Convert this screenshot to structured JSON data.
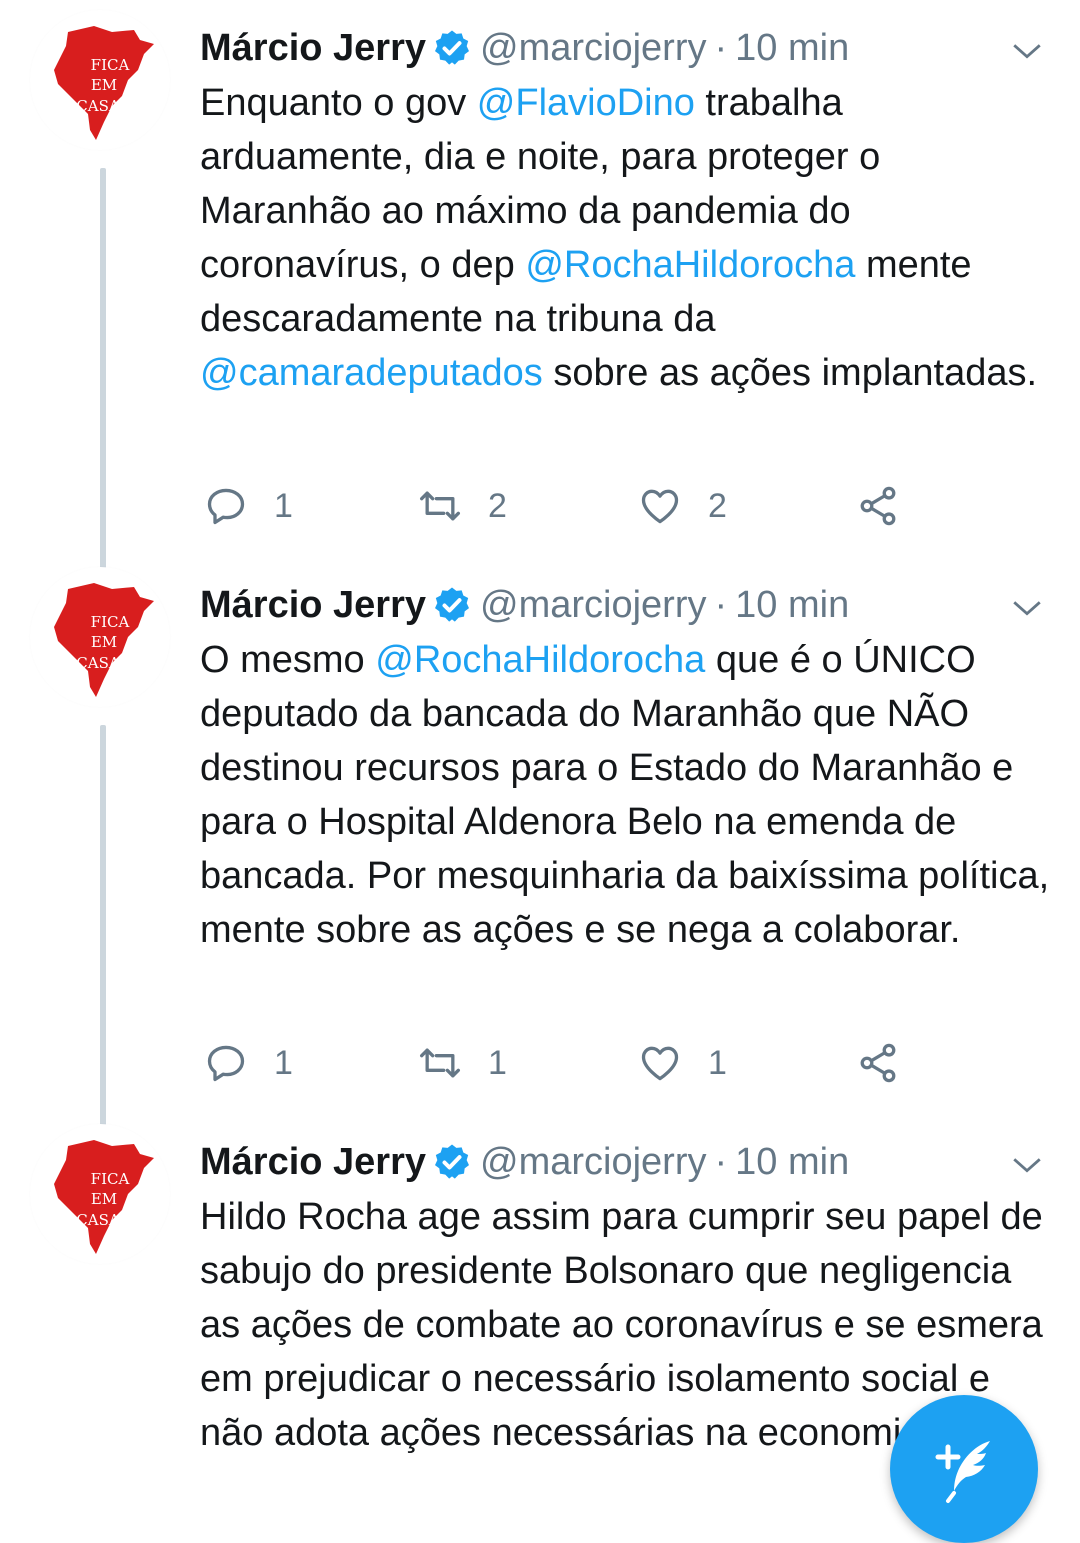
{
  "fab": {
    "icon": "compose-tweet-icon"
  },
  "colors": {
    "accent": "#1da1f2",
    "secondary_text": "#657786",
    "avatar_red": "#d81e1e"
  },
  "tweets": [
    {
      "author": {
        "name": "Márcio Jerry",
        "handle": "@marciojerry",
        "verified": true,
        "avatar_text": [
          "FICA",
          "EM",
          "CASA"
        ]
      },
      "separator": "·",
      "time": "10 min",
      "body": [
        {
          "text": "Enquanto o gov "
        },
        {
          "text": "@FlavioDino",
          "mention": true
        },
        {
          "text": " trabalha arduamente, dia e noite, para proteger o Maranhão ao máximo da pandemia do coronavírus, o dep "
        },
        {
          "text": "@RochaHildorocha",
          "mention": true
        },
        {
          "text": " mente descaradamente na tribuna da "
        },
        {
          "text": "@camaradeputados",
          "mention": true
        },
        {
          "text": " sobre as ações implantadas."
        }
      ],
      "stats": {
        "replies": "1",
        "retweets": "2",
        "likes": "2"
      }
    },
    {
      "author": {
        "name": "Márcio Jerry",
        "handle": "@marciojerry",
        "verified": true,
        "avatar_text": [
          "FICA",
          "EM",
          "CASA"
        ]
      },
      "separator": "·",
      "time": "10 min",
      "body": [
        {
          "text": "O mesmo "
        },
        {
          "text": "@RochaHildorocha",
          "mention": true
        },
        {
          "text": " que é o ÚNICO deputado da bancada do Maranhão que NÃO destinou recursos para o Estado do Maranhão e para o Hospital Aldenora Belo na emenda de bancada. Por mesquinharia da baixíssima política, mente sobre as ações e se nega a colaborar."
        }
      ],
      "stats": {
        "replies": "1",
        "retweets": "1",
        "likes": "1"
      }
    },
    {
      "author": {
        "name": "Márcio Jerry",
        "handle": "@marciojerry",
        "verified": true,
        "avatar_text": [
          "FICA",
          "EM",
          "CASA"
        ]
      },
      "separator": "·",
      "time": "10 min",
      "body": [
        {
          "text": "Hildo Rocha age assim para cumprir seu papel de sabujo do presidente Bolsonaro que negligencia as ações de combate ao coronavírus e se esmera em prejudicar o necessário isolamento social e não adota ações necessárias na economia."
        }
      ],
      "stats": null
    }
  ]
}
